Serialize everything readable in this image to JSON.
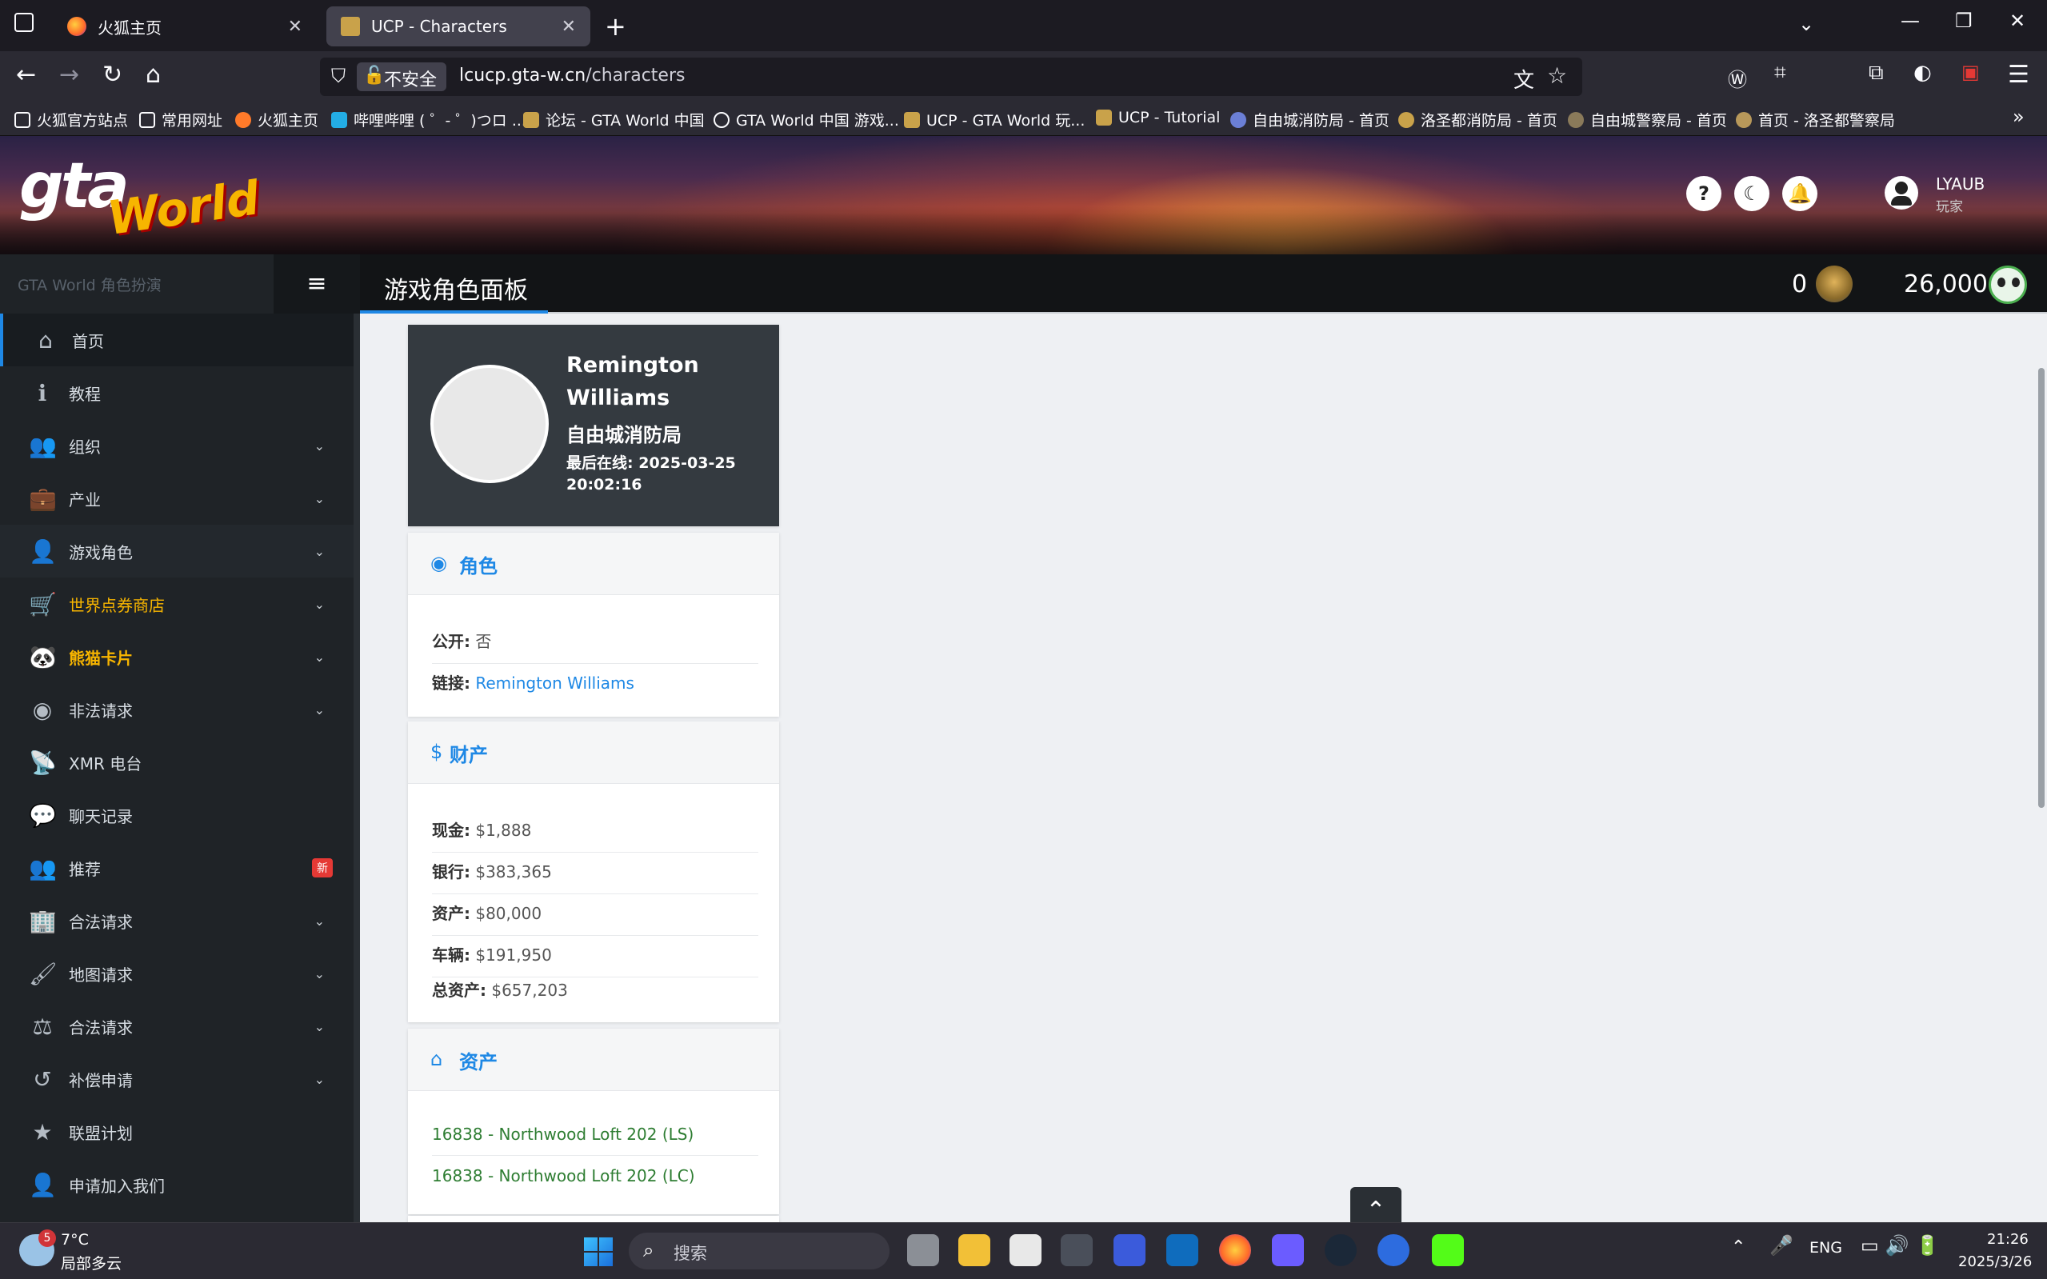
{
  "browser": {
    "tabs": [
      {
        "title": "火狐主页"
      },
      {
        "title": "UCP - Characters"
      }
    ],
    "insecure_label": "不安全",
    "url_host": "lcucp.gta-w.cn",
    "url_path": "/characters",
    "bookmarks": [
      "火狐官方站点",
      "常用网址",
      "火狐主页",
      "哔哩哔哩 ( ゜- ゜)つロ ...",
      "论坛 - GTA World 中国",
      "GTA World 中国 游戏...",
      "UCP - GTA World 玩...",
      "UCP - Tutorial",
      "自由城消防局 - 首页",
      "洛圣都消防局 - 首页",
      "自由城警察局 - 首页",
      "首页 - 洛圣都警察局"
    ]
  },
  "header": {
    "logo_gta": "gta",
    "logo_world": "World",
    "help_glyph": "?",
    "username": "LYAUB",
    "user_role": "玩家"
  },
  "topbar": {
    "sidebar_caption": "GTA World 角色扮演",
    "page_title": "游戏角色面板",
    "coins": "0",
    "points": "26,000"
  },
  "sidebar": {
    "items": [
      {
        "label": "首页"
      },
      {
        "label": "教程"
      },
      {
        "label": "组织"
      },
      {
        "label": "产业"
      },
      {
        "label": "游戏角色"
      },
      {
        "label": "世界点券商店"
      },
      {
        "label": "熊猫卡片"
      },
      {
        "label": "非法请求"
      },
      {
        "label": "XMR 电台"
      },
      {
        "label": "聊天记录"
      },
      {
        "label": "推荐",
        "badge": "新"
      },
      {
        "label": "合法请求"
      },
      {
        "label": "地图请求"
      },
      {
        "label": "合法请求"
      },
      {
        "label": "补偿申请"
      },
      {
        "label": "联盟计划"
      },
      {
        "label": "申请加入我们"
      }
    ]
  },
  "character": {
    "name": "Remington Williams",
    "faction": "自由城消防局",
    "last_online_label": "最后在线:",
    "last_online": "2025-03-25 20:02:16"
  },
  "role_card": {
    "title": "角色",
    "public_label": "公开:",
    "public_value": "否",
    "link_label": "链接:",
    "link_value": "Remington Williams"
  },
  "assets_card": {
    "title": "财产",
    "rows": [
      {
        "label": "现金:",
        "value": "$1,888"
      },
      {
        "label": "银行:",
        "value": "$383,365"
      },
      {
        "label": "资产:",
        "value": "$80,000"
      },
      {
        "label": "车辆:",
        "value": "$191,950"
      },
      {
        "label": "总资产:",
        "value": "$657,203"
      }
    ]
  },
  "properties_card": {
    "title": "资产",
    "items": [
      "16838 - Northwood Loft 202 (LS)",
      "16838 - Northwood Loft 202 (LC)"
    ]
  },
  "taskbar": {
    "weather_badge": "5",
    "temperature": "7°C",
    "condition": "局部多云",
    "search_placeholder": "搜索",
    "language": "ENG",
    "time": "21:26",
    "date": "2025/3/26"
  },
  "colors": {
    "accent": "#1e88e5",
    "gold": "#f7b500",
    "sidebar_bg": "#1f2327",
    "content_bg": "#eef0f3",
    "property_green": "#2e7d32"
  }
}
